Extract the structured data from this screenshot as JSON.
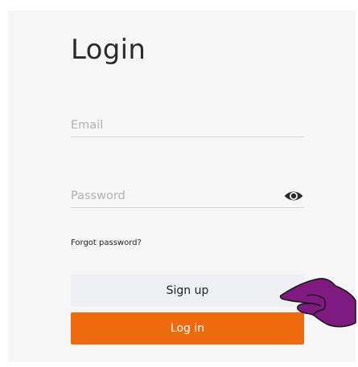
{
  "login": {
    "title": "Login",
    "email_placeholder": "Email",
    "password_placeholder": "Password",
    "forgot_password": "Forgot password?",
    "signup_label": "Sign up",
    "login_label": "Log in"
  },
  "icons": {
    "show_password": "eye-icon",
    "pointer": "pointing-hand-icon"
  },
  "colors": {
    "panel_background": "#f6f6f6",
    "signup_button": "#edeff3",
    "login_button": "#ee6a0c",
    "pointer_hand": "#7e1a80"
  }
}
